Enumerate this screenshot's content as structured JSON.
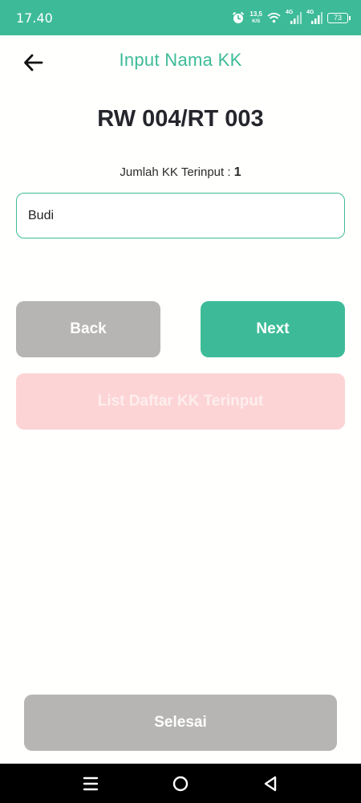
{
  "status_bar": {
    "time": "17.40",
    "speed_value": "13,5",
    "speed_unit": "K/S",
    "network_1": "4G",
    "network_2": "4G",
    "battery": "73",
    "icons": [
      "alarm-icon",
      "wifi-icon",
      "signal-icon",
      "signal-icon",
      "battery-icon"
    ]
  },
  "header": {
    "title": "Input Nama KK",
    "back_icon": "arrow-left-icon"
  },
  "location": {
    "title": "RW 004/RT 003"
  },
  "count": {
    "label": "Jumlah KK Terinput : ",
    "value": "1"
  },
  "name_input": {
    "value": "Budi"
  },
  "buttons": {
    "back": "Back",
    "next": "Next",
    "list": "List Daftar KK Terinput",
    "finish": "Selesai"
  },
  "colors": {
    "accent": "#3dbb98",
    "button_gray": "#b6b5b3",
    "button_disabled_pink": "#fdd4d5",
    "title_dark": "#25262c"
  },
  "nav_bar": {
    "icons": [
      "menu-icon",
      "home-icon",
      "back-triangle-icon"
    ]
  }
}
